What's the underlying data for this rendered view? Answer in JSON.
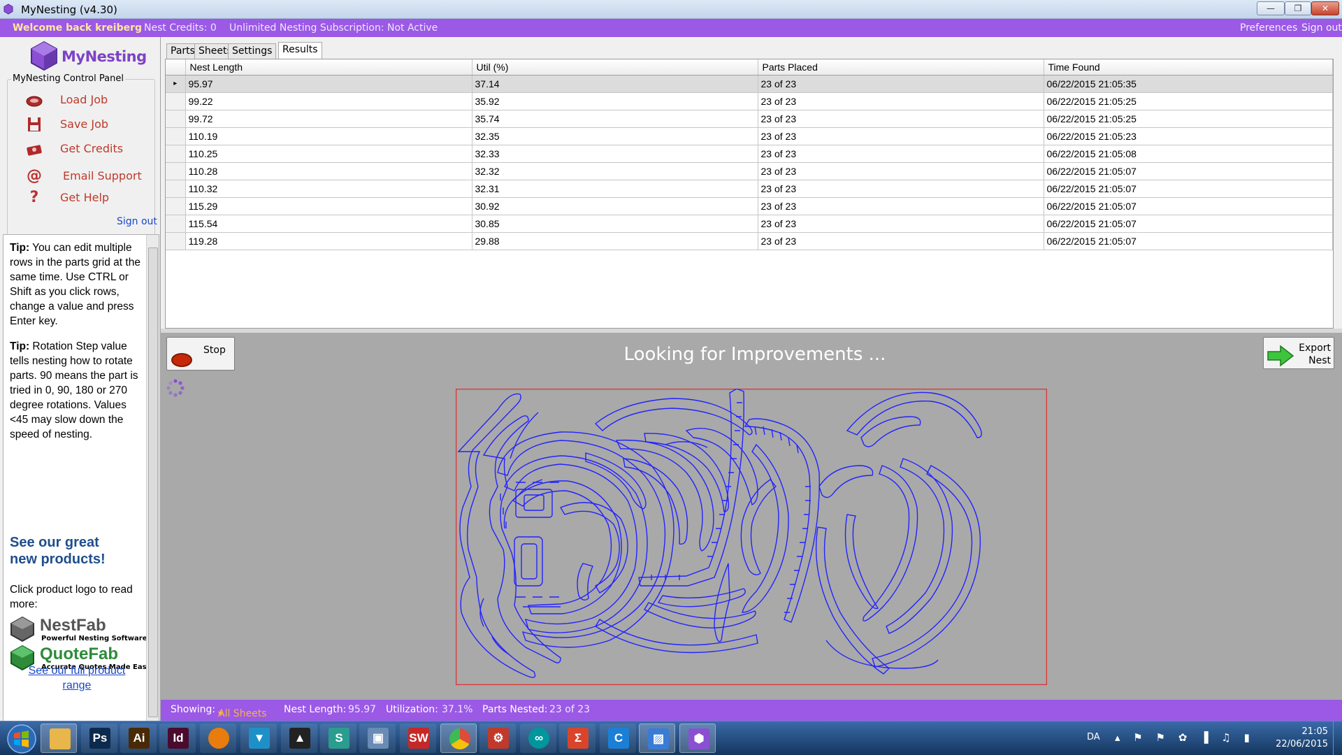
{
  "window": {
    "title": "MyNesting (v4.30)",
    "controls": {
      "minimize": "—",
      "maximize": "❐",
      "close": "✕"
    }
  },
  "account_bar": {
    "welcome": "Welcome back kreiberg",
    "credits": "Nest Credits:  0",
    "subscription": "Unlimited Nesting Subscription:  Not Active",
    "preferences": "Preferences",
    "sign_out": "Sign out"
  },
  "control_panel": {
    "logo_text": "MyNesting",
    "title": "MyNesting Control Panel",
    "items": [
      {
        "label": "Load Job",
        "icon": "load-job-icon"
      },
      {
        "label": "Save Job",
        "icon": "floppy-disk-icon"
      },
      {
        "label": "Get Credits",
        "icon": "credits-icon"
      },
      {
        "label": "Email Support",
        "icon": "at-sign-icon"
      },
      {
        "label": "Get Help",
        "icon": "question-mark-icon"
      }
    ],
    "sign_out": "Sign out"
  },
  "tips": {
    "tip1_label": "Tip:",
    "tip1_text": " You can edit multiple rows in the parts grid at the same time.  Use CTRL or Shift as you click rows, change a value and press Enter key.",
    "tip2_label": "Tip:",
    "tip2_text": " Rotation Step value tells nesting how to rotate parts. 90 means the part is tried in 0, 90, 180 or 270 degree rotations. Values <45 may slow down the speed of nesting.",
    "see_products": "See our great new products!",
    "click_logo": "Click product logo to read more:",
    "brands": [
      {
        "name": "NestFab",
        "tagline": "Powerful Nesting Software",
        "color": "#555555"
      },
      {
        "name": "QuoteFab",
        "tagline": "Accurate Quotes Made Easy",
        "color": "#2e8b3a"
      }
    ],
    "full_range_link": "See our full product range"
  },
  "tabs": [
    {
      "label": "Parts",
      "active": false
    },
    {
      "label": "Sheets",
      "active": false
    },
    {
      "label": "Settings",
      "active": false
    },
    {
      "label": "Results",
      "active": true
    }
  ],
  "results": {
    "columns": [
      "Nest Length",
      "Util (%)",
      "Parts Placed",
      "Time Found"
    ],
    "rows": [
      [
        "95.97",
        "37.14",
        "23 of 23",
        "06/22/2015 21:05:35"
      ],
      [
        "99.22",
        "35.92",
        "23 of 23",
        "06/22/2015 21:05:25"
      ],
      [
        "99.72",
        "35.74",
        "23 of 23",
        "06/22/2015 21:05:25"
      ],
      [
        "110.19",
        "32.35",
        "23 of 23",
        "06/22/2015 21:05:23"
      ],
      [
        "110.25",
        "32.33",
        "23 of 23",
        "06/22/2015 21:05:08"
      ],
      [
        "110.28",
        "32.32",
        "23 of 23",
        "06/22/2015 21:05:07"
      ],
      [
        "110.32",
        "32.31",
        "23 of 23",
        "06/22/2015 21:05:07"
      ],
      [
        "115.29",
        "30.92",
        "23 of 23",
        "06/22/2015 21:05:07"
      ],
      [
        "115.54",
        "30.85",
        "23 of 23",
        "06/22/2015 21:05:07"
      ],
      [
        "119.28",
        "29.88",
        "23 of 23",
        "06/22/2015 21:05:07"
      ]
    ],
    "selected_row": 0
  },
  "nesting": {
    "stop_label": "Stop",
    "status_message": "Looking for Improvements ...",
    "export_label_1": "Export",
    "export_label_2": "Nest",
    "sheet_border_color": "#e03030",
    "part_color": "#1a1aff"
  },
  "status_bar": {
    "showing_label": "Showing:",
    "showing_value": "All Sheets",
    "nest_length_label": "Nest Length:",
    "nest_length_value": "95.97",
    "utilization_label": "Utilization:",
    "utilization_value": "37.1%",
    "parts_nested_label": "Parts Nested:",
    "parts_nested_value": "23 of 23"
  },
  "taskbar": {
    "apps": [
      {
        "name": "file-explorer",
        "glyph": "",
        "color": "#e8b64a"
      },
      {
        "name": "photoshop",
        "glyph": "Ps",
        "color": "#0b2a4d"
      },
      {
        "name": "illustrator",
        "glyph": "Ai",
        "color": "#4a2a06"
      },
      {
        "name": "indesign",
        "glyph": "Id",
        "color": "#4b0b2e"
      },
      {
        "name": "blender",
        "glyph": "",
        "color": "#e87d0d"
      },
      {
        "name": "vectorworks",
        "glyph": "▼",
        "color": "#1e90c8"
      },
      {
        "name": "inkscape",
        "glyph": "▲",
        "color": "#222222"
      },
      {
        "name": "sketch-app",
        "glyph": "S",
        "color": "#2a9d8f"
      },
      {
        "name": "virtualbox",
        "glyph": "▣",
        "color": "#6a8bb5"
      },
      {
        "name": "solidworks",
        "glyph": "SW",
        "color": "#c62828"
      },
      {
        "name": "chrome",
        "glyph": "",
        "color": "#dd4b39"
      },
      {
        "name": "settings-app",
        "glyph": "⚙",
        "color": "#c0392b"
      },
      {
        "name": "arduino",
        "glyph": "∞",
        "color": "#00979c"
      },
      {
        "name": "slicer-app",
        "glyph": "Σ",
        "color": "#d9452b"
      },
      {
        "name": "c-app",
        "glyph": "C",
        "color": "#1b7fd6"
      },
      {
        "name": "photo-viewer",
        "glyph": "▨",
        "color": "#3a7bd5"
      },
      {
        "name": "mynesting",
        "glyph": "⬢",
        "color": "#8a4fd3"
      }
    ],
    "tray_lang": "DA",
    "tray_icons": "▴ ⚑ ⚑ ✿ ▐ ♫ ▮",
    "time": "21:05",
    "date": "22/06/2015"
  }
}
